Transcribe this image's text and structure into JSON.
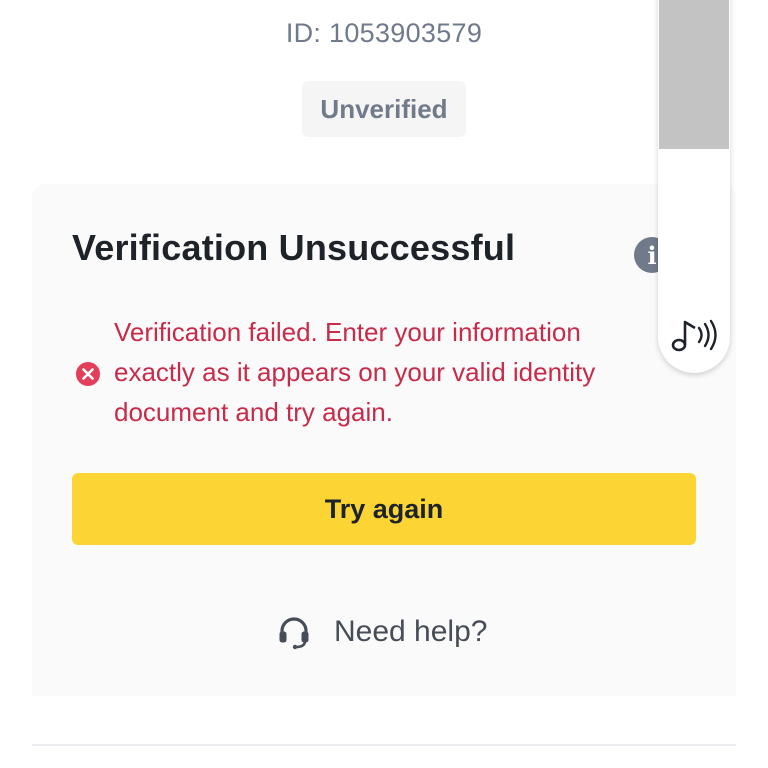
{
  "account": {
    "id_text": "ID: 1053903579",
    "status_badge": "Unverified"
  },
  "verification_card": {
    "title": "Verification Unsuccessful",
    "info_icon_glyph": "i",
    "error_message": "Verification failed. Enter your information exactly as it appears on your valid identity document and try again.",
    "try_again_label": "Try again",
    "help_label": "Need help?"
  },
  "icons": {
    "info": "info-icon",
    "error": "error-x-circle-icon",
    "help": "headset-icon",
    "audio": "music-note-sound-icon"
  },
  "colors": {
    "accent_yellow": "#fcd535",
    "error_red": "#c82b4a",
    "muted_gray": "#707a8a",
    "title_dark": "#1e2329",
    "card_bg": "#fafafa"
  }
}
